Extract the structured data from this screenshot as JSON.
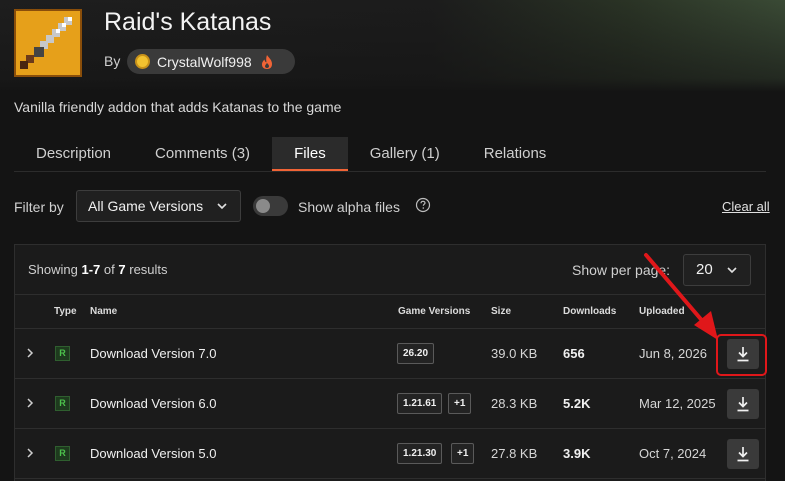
{
  "mod": {
    "title": "Raid's Katanas",
    "by_label": "By",
    "author": "CrystalWolf998",
    "description": "Vanilla friendly addon that adds Katanas to the game"
  },
  "tabs": [
    {
      "label": "Description",
      "active": false
    },
    {
      "label": "Comments (3)",
      "active": false
    },
    {
      "label": "Files",
      "active": true
    },
    {
      "label": "Gallery (1)",
      "active": false
    },
    {
      "label": "Relations",
      "active": false
    }
  ],
  "filters": {
    "filter_label": "Filter by",
    "game_version_selected": "All Game Versions",
    "alpha_label": "Show alpha files",
    "alpha_enabled": false,
    "clear_all": "Clear all"
  },
  "results": {
    "showing_prefix": "Showing",
    "range": "1-7",
    "of": "of",
    "total": "7",
    "suffix": "results",
    "per_page_label": "Show per page:",
    "per_page_value": "20"
  },
  "table": {
    "headers": {
      "type": "Type",
      "name": "Name",
      "game_versions": "Game Versions",
      "size": "Size",
      "downloads": "Downloads",
      "uploaded": "Uploaded"
    },
    "rows": [
      {
        "type": "R",
        "name": "Download Version 7.0",
        "version": "26.20",
        "extra": "",
        "size": "39.0 KB",
        "downloads": "656",
        "uploaded": "Jun 8, 2026"
      },
      {
        "type": "R",
        "name": "Download Version 6.0",
        "version": "1.21.61",
        "extra": "+1",
        "size": "28.3 KB",
        "downloads": "5.2K",
        "uploaded": "Mar 12, 2025"
      },
      {
        "type": "R",
        "name": "Download Version 5.0",
        "version": "1.21.30",
        "extra": "+1",
        "size": "27.8 KB",
        "downloads": "3.9K",
        "uploaded": "Oct 7, 2024"
      }
    ]
  },
  "colors": {
    "accent": "#f16436",
    "highlight": "#e0171a",
    "release": "#4cc24c"
  }
}
